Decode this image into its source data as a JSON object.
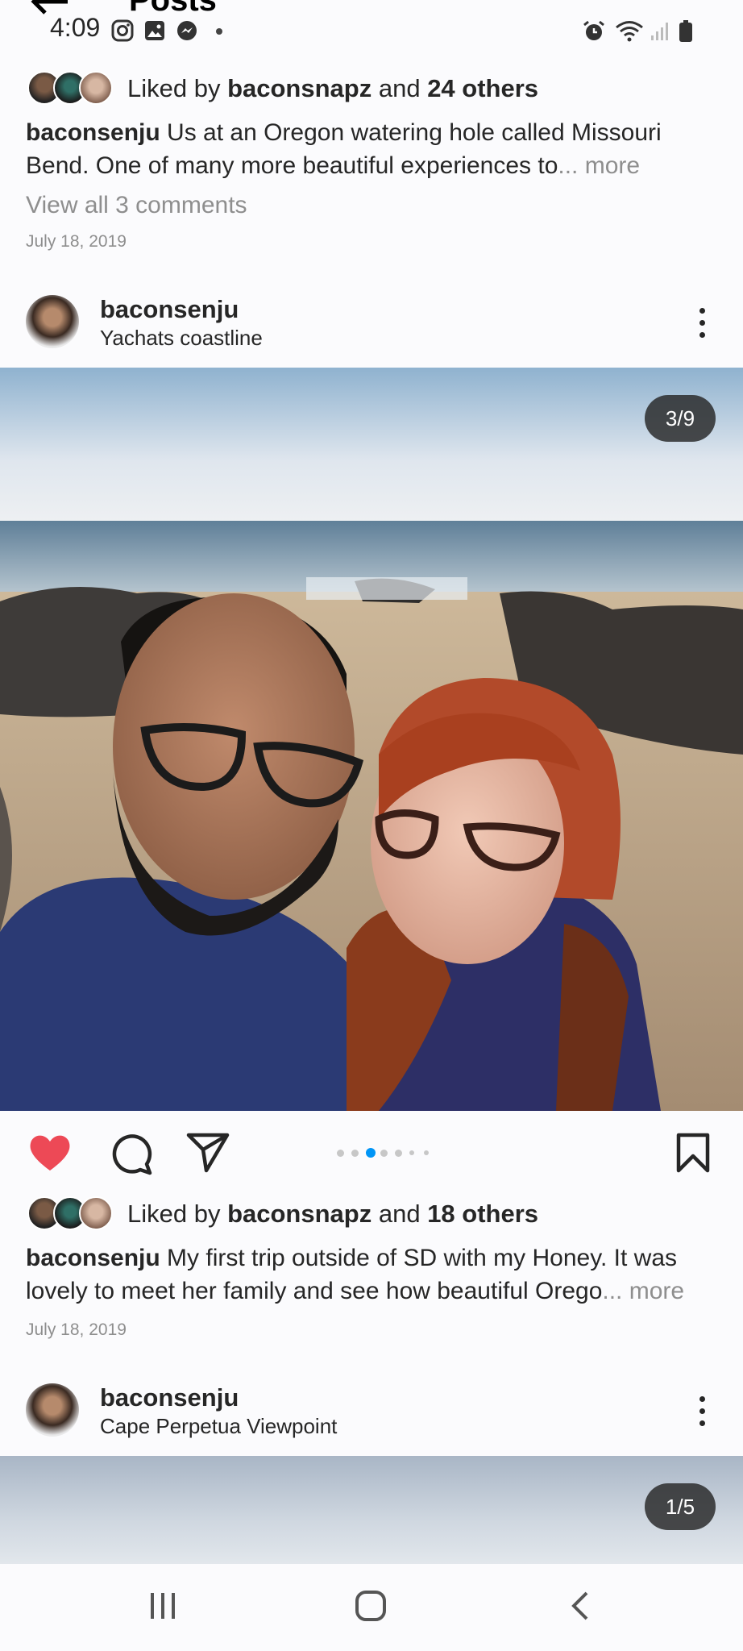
{
  "app_bar": {
    "title": "Posts"
  },
  "status_bar": {
    "time": "4:09"
  },
  "post1": {
    "liked_prefix": "Liked by ",
    "liked_user": "baconsnapz",
    "liked_mid": " and ",
    "liked_count": "24 others",
    "caption_user": "baconsenju",
    "caption_text": " Us at an Oregon watering hole called Missouri Bend. One of many more beautiful  experiences to",
    "more_label": "... more",
    "comments_label": "View all 3 comments",
    "date": "July 18, 2019"
  },
  "post2": {
    "username": "baconsenju",
    "location": "Yachats coastline",
    "counter": "3/9",
    "carousel_total": 7,
    "carousel_active": 2,
    "liked_prefix": "Liked by ",
    "liked_user": "baconsnapz",
    "liked_mid": " and ",
    "liked_count": "18 others",
    "caption_user": "baconsenju",
    "caption_text": " My first trip outside of SD with my Honey. It was lovely  to meet her family and see how beautiful  Orego",
    "more_label": "... more",
    "date": "July 18, 2019"
  },
  "post3": {
    "username": "baconsenju",
    "location": "Cape Perpetua Viewpoint",
    "counter": "1/5"
  },
  "colors": {
    "like_red": "#ed4956",
    "carousel_active": "#0095f6",
    "text": "#262626",
    "muted": "#8e8e8e"
  }
}
